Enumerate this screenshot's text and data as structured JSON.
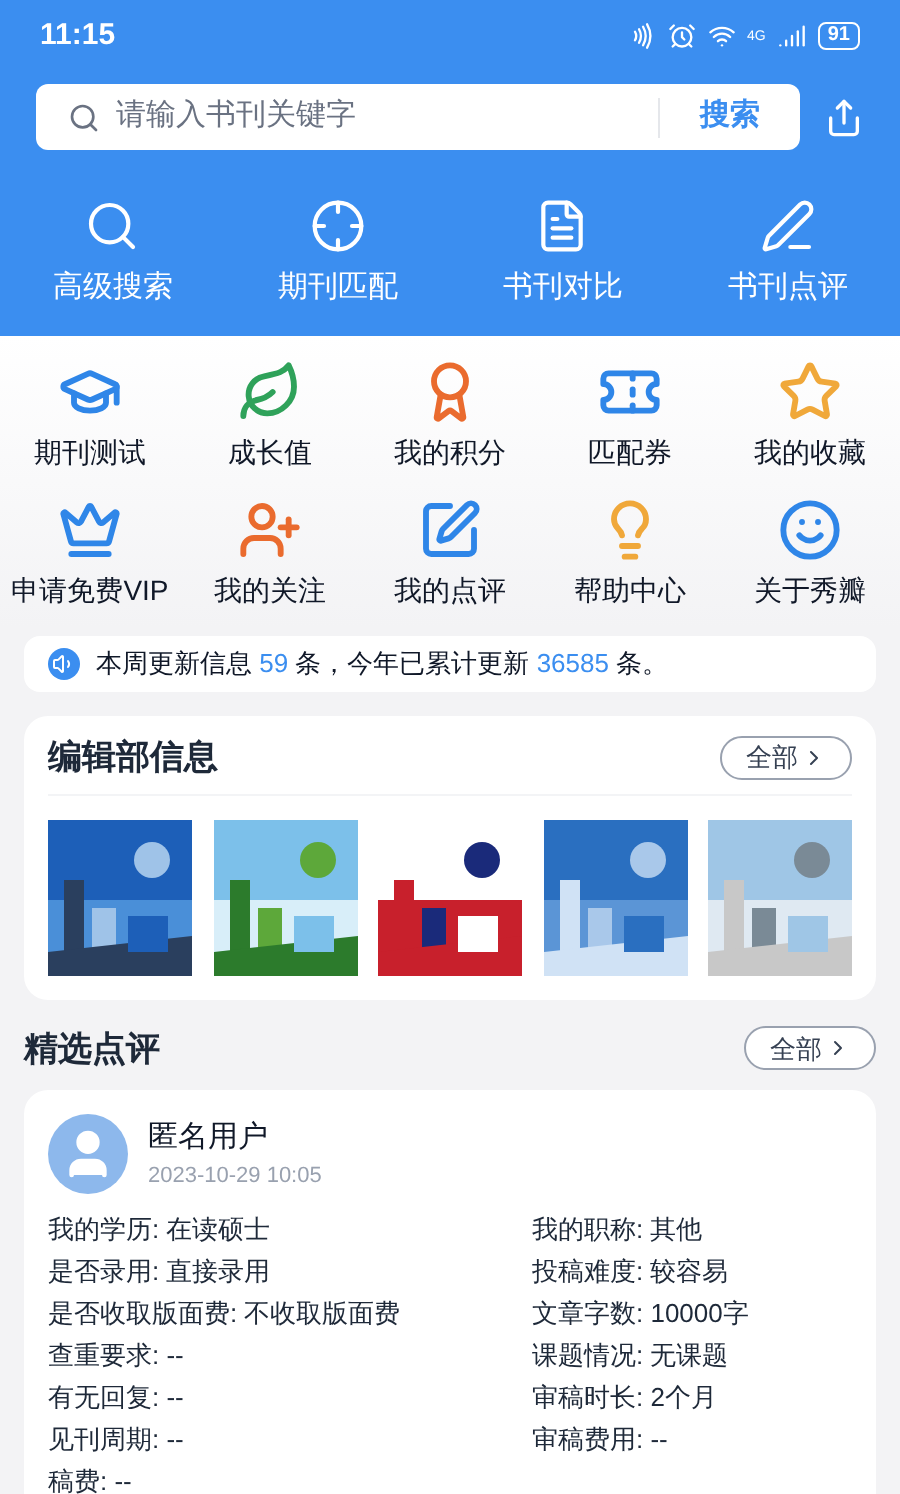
{
  "status_bar": {
    "time": "11:15",
    "network": "4G",
    "battery": "91"
  },
  "search": {
    "placeholder": "请输入书刊关键字",
    "button": "搜索"
  },
  "top_actions": [
    {
      "label": "高级搜索",
      "kind": "search"
    },
    {
      "label": "期刊匹配",
      "kind": "target"
    },
    {
      "label": "书刊对比",
      "kind": "compare"
    },
    {
      "label": "书刊点评",
      "kind": "pen"
    }
  ],
  "grid": [
    {
      "label": "期刊测试",
      "kind": "cap"
    },
    {
      "label": "成长值",
      "kind": "leaf"
    },
    {
      "label": "我的积分",
      "kind": "medal"
    },
    {
      "label": "匹配券",
      "kind": "ticket"
    },
    {
      "label": "我的收藏",
      "kind": "star"
    },
    {
      "label": "申请免费VIP",
      "kind": "crown"
    },
    {
      "label": "我的关注",
      "kind": "follow"
    },
    {
      "label": "我的点评",
      "kind": "edit"
    },
    {
      "label": "帮助中心",
      "kind": "bulb"
    },
    {
      "label": "关于秀瓣",
      "kind": "mascot"
    }
  ],
  "notice": [
    {
      "text": "本周更新信息 ",
      "highlight": false
    },
    {
      "text": "59",
      "highlight": true
    },
    {
      "text": " 条，今年已累计更新 ",
      "highlight": false
    },
    {
      "text": "36585",
      "highlight": true
    },
    {
      "text": " 条。",
      "highlight": false
    }
  ],
  "editorial": {
    "title": "编辑部信息",
    "more": "全部"
  },
  "reviews": {
    "title": "精选点评",
    "more": "全部",
    "items": [
      {
        "user": "匿名用户",
        "time": "2023-10-29 10:05",
        "rows": [
          {
            "left": "我的学历: 在读硕士",
            "right": "我的职称: 其他"
          },
          {
            "left": "是否录用: 直接录用",
            "right": "投稿难度: 较容易"
          },
          {
            "left": "是否收取版面费: 不收取版面费",
            "right": "文章字数: 10000字"
          },
          {
            "left": "查重要求: --",
            "right": "课题情况: 无课题"
          },
          {
            "left": "有无回复: --",
            "right": "审稿时长: 2个月"
          },
          {
            "left": "见刊周期: --",
            "right": "审稿费用: --"
          },
          {
            "left": "稿费: --"
          }
        ]
      }
    ]
  }
}
